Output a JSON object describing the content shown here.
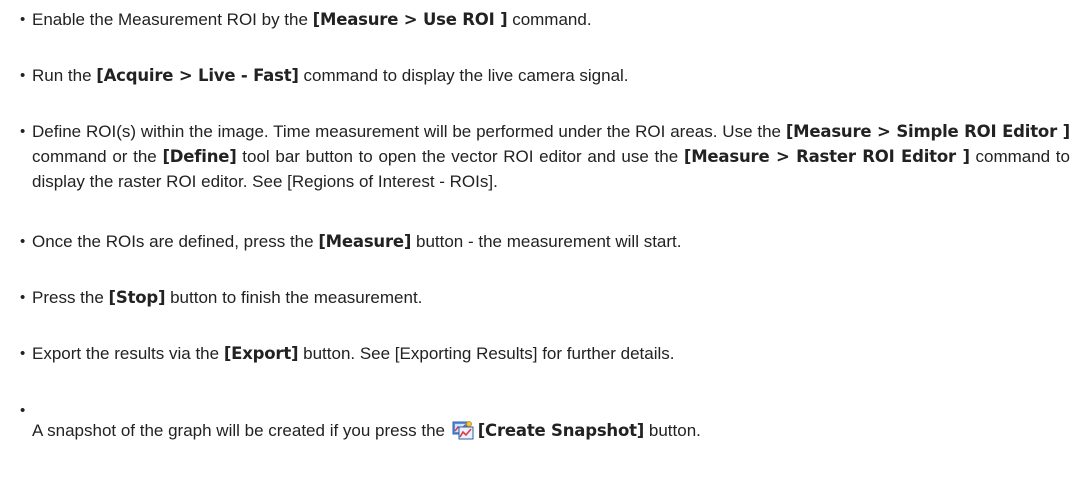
{
  "steps": [
    {
      "pre": "Enable the Measurement ROI by the ",
      "cmd": "[Measure > Use ROI ]",
      "post": " command."
    },
    {
      "pre": "Run the ",
      "cmd": "[Acquire > Live - Fast]",
      "post": " command to display the live camera signal."
    },
    {
      "pre": "Define ROI(s) within the image. Time measurement will be performed under the ROI areas. Use the ",
      "cmd": "[Measure > Simple ROI Editor ]",
      "mid": " command or the ",
      "cmd2": "[Define]",
      "mid2": " tool bar button to open the vector ROI editor and use the ",
      "cmd3": "[Measure > Raster ROI Editor ]",
      "post": " command to display the raster ROI editor. See [Regions of Interest - ROIs]."
    },
    {
      "pre": "Once the ROIs are defined, press the ",
      "cmd": "[Measure]",
      "post": " button - the measurement will start."
    },
    {
      "pre": "Press the ",
      "cmd": "[Stop]",
      "post": " button to finish the measurement."
    },
    {
      "pre": "Export the results via the ",
      "cmd": "[Export]",
      "post": " button. See [Exporting Results] for further details."
    },
    {
      "pre": "A snapshot of the graph will be created if you press the ",
      "icon": "create-snapshot-icon",
      "cmd": "[Create Snapshot]",
      "post": " button."
    }
  ],
  "bullet": "•"
}
